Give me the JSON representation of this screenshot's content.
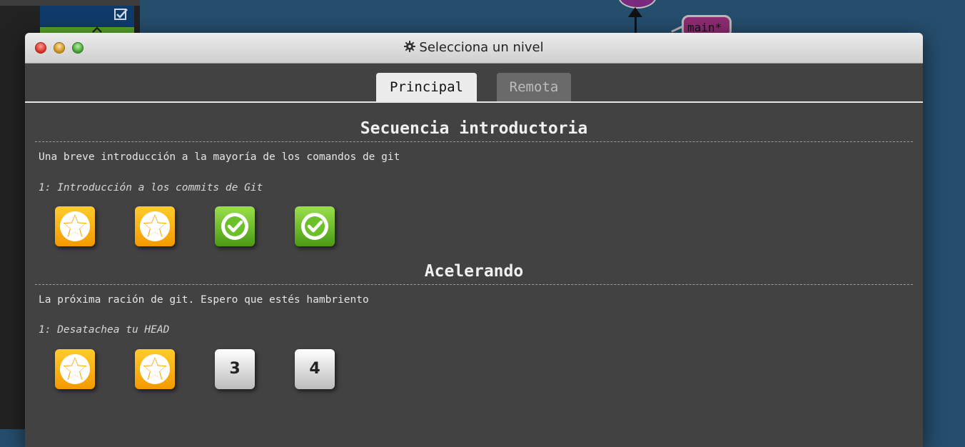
{
  "background": {
    "branch_label": "main*"
  },
  "dialog": {
    "title": "Selecciona un nivel",
    "tabs": [
      {
        "label": "Principal",
        "active": true
      },
      {
        "label": "Remota",
        "active": false
      }
    ],
    "sections": [
      {
        "title": "Secuencia introductoria",
        "description": "Una breve introducción a la mayoría de los comandos de git",
        "sequence_label": "1: Introducción a los commits de Git",
        "levels": [
          {
            "state": "star",
            "icon": "star-icon"
          },
          {
            "state": "star",
            "icon": "star-icon"
          },
          {
            "state": "completed",
            "icon": "check-icon"
          },
          {
            "state": "completed",
            "icon": "check-icon"
          }
        ]
      },
      {
        "title": "Acelerando",
        "description": "La próxima ración de git. Espero que estés hambriento",
        "sequence_label": "1: Desatachea tu HEAD",
        "levels": [
          {
            "state": "star",
            "icon": "star-icon"
          },
          {
            "state": "star",
            "icon": "star-icon"
          },
          {
            "state": "pending",
            "number": "3"
          },
          {
            "state": "pending",
            "number": "4"
          }
        ]
      }
    ]
  },
  "colors": {
    "star": "#f6a800",
    "completed": "#5fb420",
    "pending": "#e0e0e0",
    "dialog_bg": "#424242",
    "page_bg": "#254d6c"
  }
}
